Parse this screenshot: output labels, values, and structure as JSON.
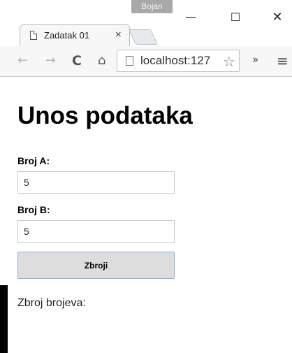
{
  "browser": {
    "profile_name": "Bojan",
    "tab_title": "Zadatak 01",
    "tab_close": "×",
    "address": "localhost:127",
    "window_controls": {
      "minimize": "—",
      "maximize": "☐",
      "close": "✕"
    },
    "icons": {
      "back": "←",
      "forward": "→",
      "reload": "C",
      "home": "⌂",
      "star": "☆",
      "extensions": "»",
      "menu": "≡"
    }
  },
  "page": {
    "heading": "Unos podataka",
    "field_a": {
      "label": "Broj A:",
      "value": "5"
    },
    "field_b": {
      "label": "Broj B:",
      "value": "5"
    },
    "submit_label": "Zbroji",
    "result_label": "Zbroj brojeva:"
  }
}
